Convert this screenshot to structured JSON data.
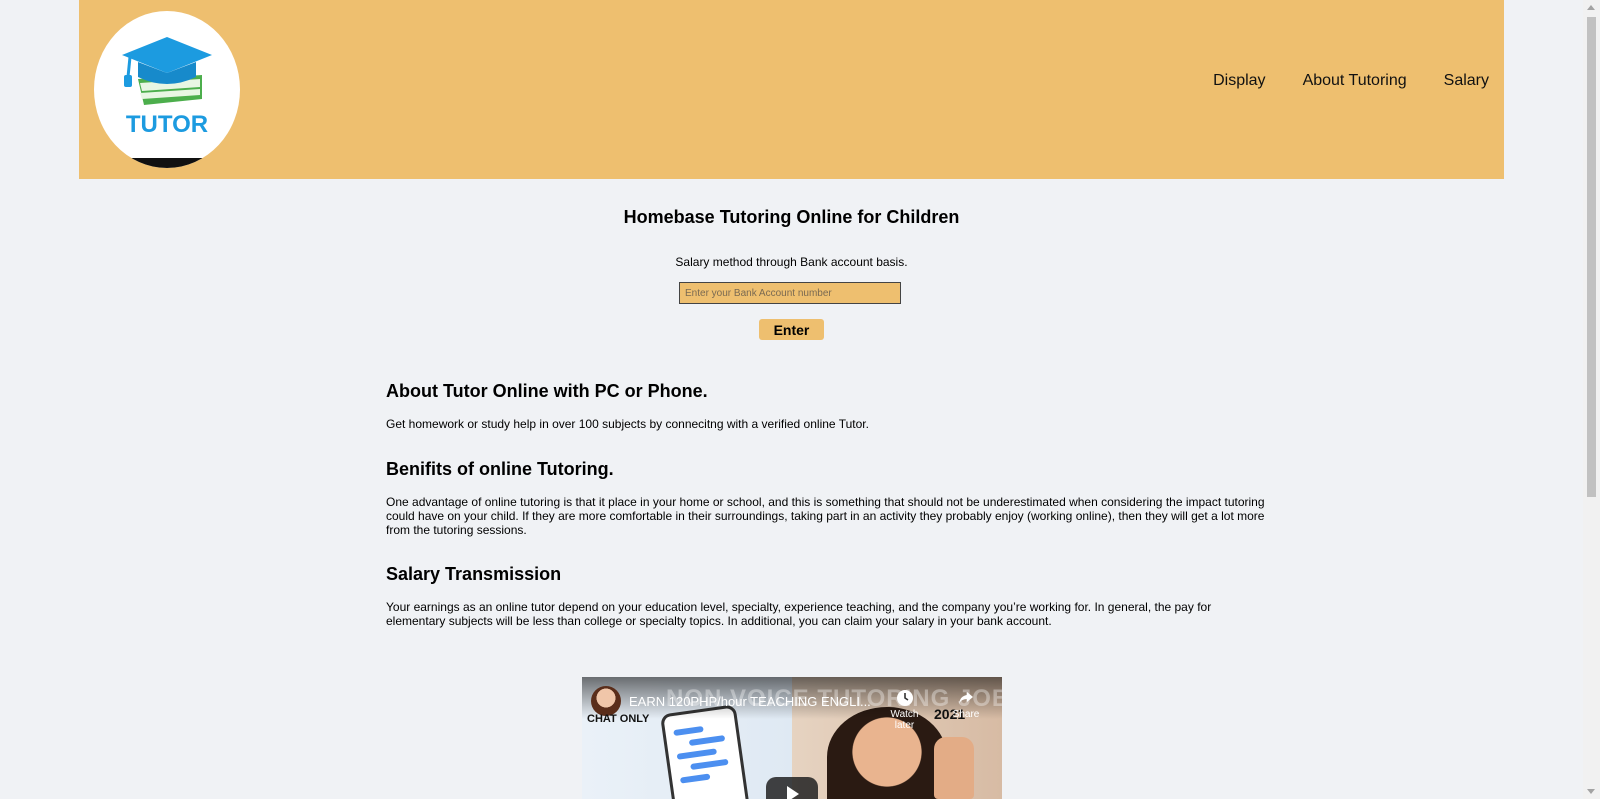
{
  "header": {
    "logo_text": "TUTOR",
    "nav": [
      "Display",
      "About Tutoring",
      "Salary"
    ]
  },
  "hero": {
    "title": "Homebase Tutoring Online for Children",
    "subtitle": "Salary method through Bank account basis.",
    "input_placeholder": "Enter your Bank Account number",
    "button_label": "Enter"
  },
  "sections": [
    {
      "heading": "About Tutor Online with PC or Phone.",
      "body": "Get homework or study help in over 100 subjects by connecitng with a verified online Tutor."
    },
    {
      "heading": "Benifits of online Tutoring.",
      "body": "One advantage of online tutoring is that it place in your home or school, and this is something that should not be underestimated when considering the impact tutoring could have on your child. If they are more comfortable in their surroundings, taking part in an activity they probably enjoy (working online), then they will get a lot more from the tutoring sessions."
    },
    {
      "heading": "Salary Transmission",
      "body": "Your earnings as an online tutor depend on your education level, specialty, experience teaching, and the company you’re working for. In general, the pay for elementary subjects will be less than college or specialty topics. In additional, you can claim your salary in your bank account."
    }
  ],
  "video": {
    "title": "EARN 120PHP/hour TEACHING ENGLI...",
    "background_text": "NON VOICE TUTORING JOBS",
    "watch_later": "Watch later",
    "share": "Share",
    "chat_only": "CHAT ONLY",
    "year": "2021"
  },
  "colors": {
    "header_bg": "#eebf6f",
    "page_bg": "#f0f2f5",
    "logo_blue": "#1c9be0",
    "logo_green": "#4cae4c"
  }
}
